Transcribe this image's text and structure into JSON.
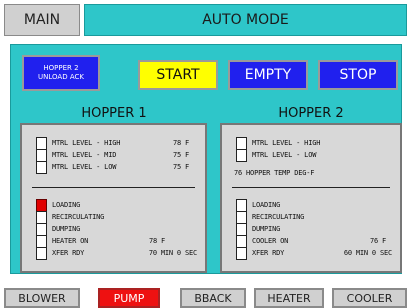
{
  "header": {
    "main_label": "MAIN",
    "mode_label": "AUTO MODE"
  },
  "controls": {
    "hopper_ack": [
      "HOPPER 2",
      "UNLOAD ACK"
    ],
    "start": "START",
    "empty": "EMPTY",
    "stop": "STOP"
  },
  "colors": {
    "accent_cyan": "#2ec6c9",
    "button_blue": "#2020ee",
    "start_yellow": "#ffff00",
    "active_red": "#ee1111"
  },
  "hopper1": {
    "title": "HOPPER 1",
    "levels": [
      {
        "label": "MTRL LEVEL - HIGH",
        "value": "78  F"
      },
      {
        "label": "MTRL LEVEL - MID",
        "value": "75  F"
      },
      {
        "label": "MTRL LEVEL - LOW",
        "value": "75  F"
      }
    ],
    "status": [
      {
        "label": "LOADING",
        "value": "",
        "on": true
      },
      {
        "label": "RECIRCULATING",
        "value": "",
        "on": false
      },
      {
        "label": "DUMPING",
        "value": "",
        "on": false
      },
      {
        "label": "HEATER ON",
        "value": "78 F",
        "on": false
      },
      {
        "label": "XFER RDY",
        "value": "70 MIN  0 SEC",
        "on": false
      }
    ]
  },
  "hopper2": {
    "title": "HOPPER 2",
    "levels": [
      {
        "label": "MTRL LEVEL - HIGH",
        "value": ""
      },
      {
        "label": "MTRL LEVEL - LOW",
        "value": ""
      }
    ],
    "temp_line": "76  HOPPER TEMP DEG-F",
    "status": [
      {
        "label": "LOADING",
        "value": "",
        "on": false
      },
      {
        "label": "RECIRCULATING",
        "value": "",
        "on": false
      },
      {
        "label": "DUMPING",
        "value": "",
        "on": false
      },
      {
        "label": "COOLER ON",
        "value": "76  F",
        "on": false
      },
      {
        "label": "XFER RDY",
        "value": "60 MIN  0 SEC",
        "on": false
      }
    ]
  },
  "bottom": [
    {
      "label": "BLOWER",
      "active": false
    },
    {
      "label": "PUMP",
      "active": true
    },
    {
      "label": "BBACK",
      "active": false
    },
    {
      "label": "HEATER",
      "active": false
    },
    {
      "label": "COOLER",
      "active": false
    }
  ]
}
